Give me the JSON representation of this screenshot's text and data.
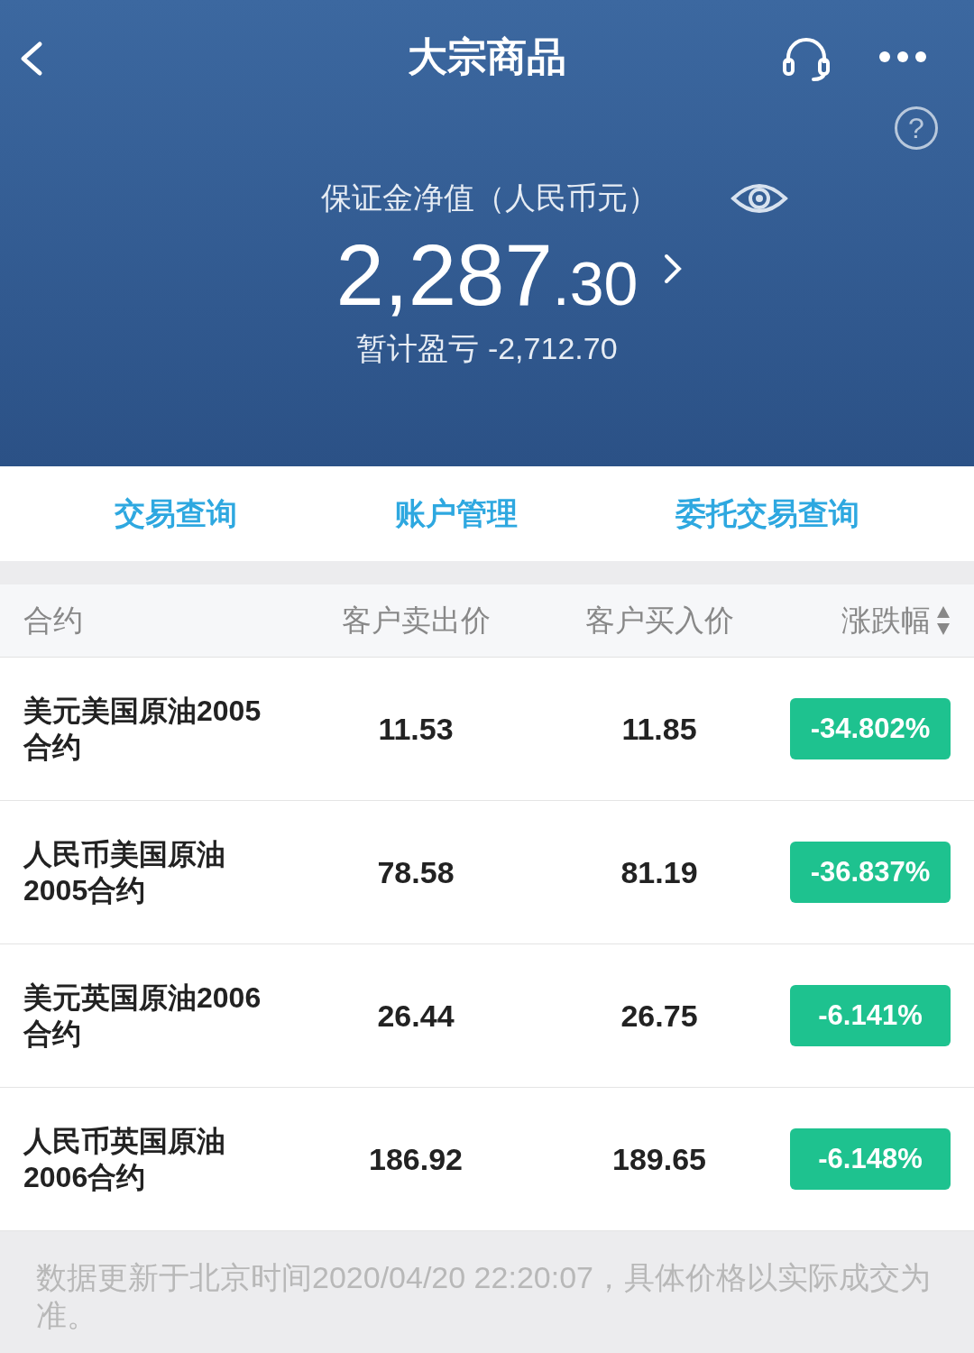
{
  "header": {
    "title": "大宗商品",
    "help_icon": "?",
    "balance_label": "保证金净值（人民币元）",
    "balance_integer": "2,287",
    "balance_decimal": ".30",
    "pnl": "暂计盈亏 -2,712.70"
  },
  "links": [
    "交易查询",
    "账户管理",
    "委托交易查询"
  ],
  "table": {
    "columns": [
      {
        "label": "合约",
        "sortable": false
      },
      {
        "label": "客户卖出价",
        "sortable": false
      },
      {
        "label": "客户买入价",
        "sortable": false
      },
      {
        "label": "涨跌幅",
        "sortable": true
      }
    ],
    "rows": [
      {
        "name": "美元美国原油2005合约",
        "sell": "11.53",
        "buy": "11.85",
        "change": "-34.802%",
        "color": "#1ec28f"
      },
      {
        "name": "人民币美国原油2005合约",
        "sell": "78.58",
        "buy": "81.19",
        "change": "-36.837%",
        "color": "#1ec28f"
      },
      {
        "name": "美元英国原油2006合约",
        "sell": "26.44",
        "buy": "26.75",
        "change": "-6.141%",
        "color": "#1ec28f"
      },
      {
        "name": "人民币英国原油2006合约",
        "sell": "186.92",
        "buy": "189.65",
        "change": "-6.148%",
        "color": "#1ec28f"
      }
    ]
  },
  "footer": "数据更新于北京时间2020/04/20 22:20:07，具体价格以实际成交为准。"
}
